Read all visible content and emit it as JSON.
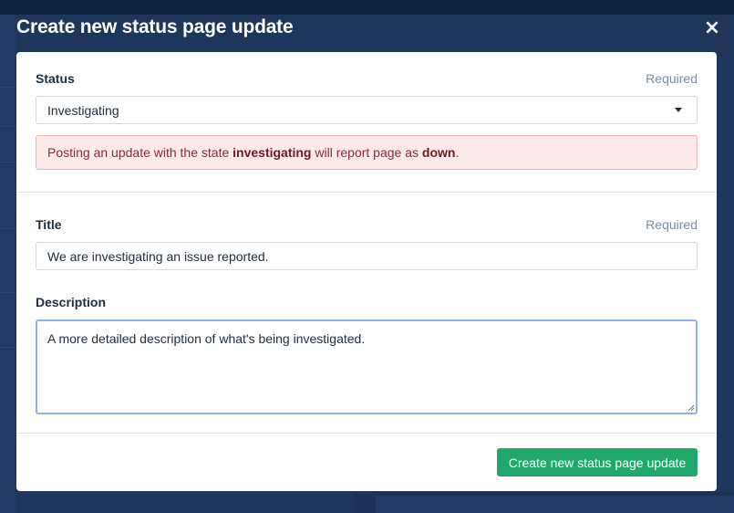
{
  "modal": {
    "title": "Create new status page update",
    "close_symbol": "×"
  },
  "status_field": {
    "label": "Status",
    "required_text": "Required",
    "selected_value": "Investigating",
    "icon": "chevron-down-icon"
  },
  "alert": {
    "text_before": "Posting an update with the state ",
    "state": "investigating",
    "text_middle": " will report page as ",
    "result": "down",
    "text_after": "."
  },
  "title_field": {
    "label": "Title",
    "required_text": "Required",
    "value": "We are investigating an issue reported."
  },
  "description_field": {
    "label": "Description",
    "value": "A more detailed description of what's being investigated."
  },
  "footer": {
    "submit_label": "Create new status page update"
  },
  "colors": {
    "backdrop": "#1f365b",
    "submit": "#22a86a",
    "alert_background": "#fde8ea",
    "focus_border": "#8bb5ea"
  }
}
